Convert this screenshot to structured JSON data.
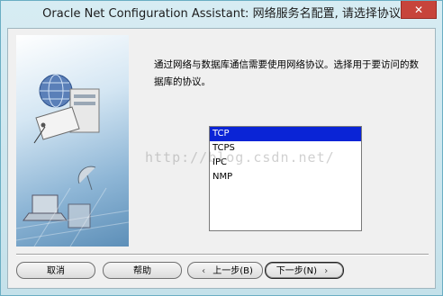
{
  "window": {
    "title": "Oracle Net Configuration Assistant: 网络服务名配置, 请选择协议",
    "close_glyph": "✕"
  },
  "content": {
    "description": "通过网络与数据库通信需要使用网络协议。选择用于要访问的数据库的协议。"
  },
  "protocol_list": {
    "items": [
      "TCP",
      "TCPS",
      "IPC",
      "NMP"
    ],
    "selected": "TCP"
  },
  "buttons": {
    "cancel": "取消",
    "help": "帮助",
    "back": "上一步(B)",
    "next": "下一步(N)",
    "back_chevron": "‹",
    "next_chevron": "›"
  },
  "watermark": "http://blog.csdn.net/",
  "colors": {
    "selection": "#0a24d6",
    "close": "#c7443b"
  },
  "icons": {
    "art": "network-server-illustration"
  }
}
